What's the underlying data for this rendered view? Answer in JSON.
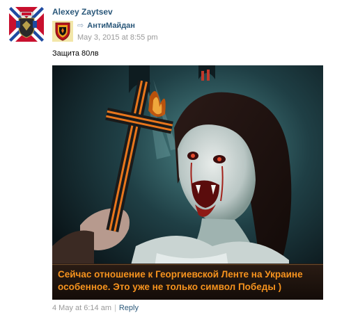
{
  "post": {
    "author": "Alexey Zaytsev",
    "repost": {
      "source": "АнтиМайдан",
      "date": "May 3, 2015 at 8:55 pm"
    },
    "text": "Защита 80лв",
    "image": {
      "caption_line1": "Сейчас отношение к Георгиевской Ленте на Украине",
      "caption_line2": "особенное. Это уже не только символ Победы )"
    },
    "footer": {
      "date": "4 May at 6:14 am",
      "separator": "|",
      "reply": "Reply"
    }
  },
  "colors": {
    "link": "#2b587a",
    "meta": "#999999",
    "caption": "#f7931e",
    "ribbon_orange": "#e8761c",
    "ribbon_black": "#1a1a1a"
  },
  "icons": {
    "author_avatar": "novorossiya-flag-coat-of-arms",
    "source_avatar": "shield-emblem",
    "repost": "repost-arrow-icon"
  }
}
